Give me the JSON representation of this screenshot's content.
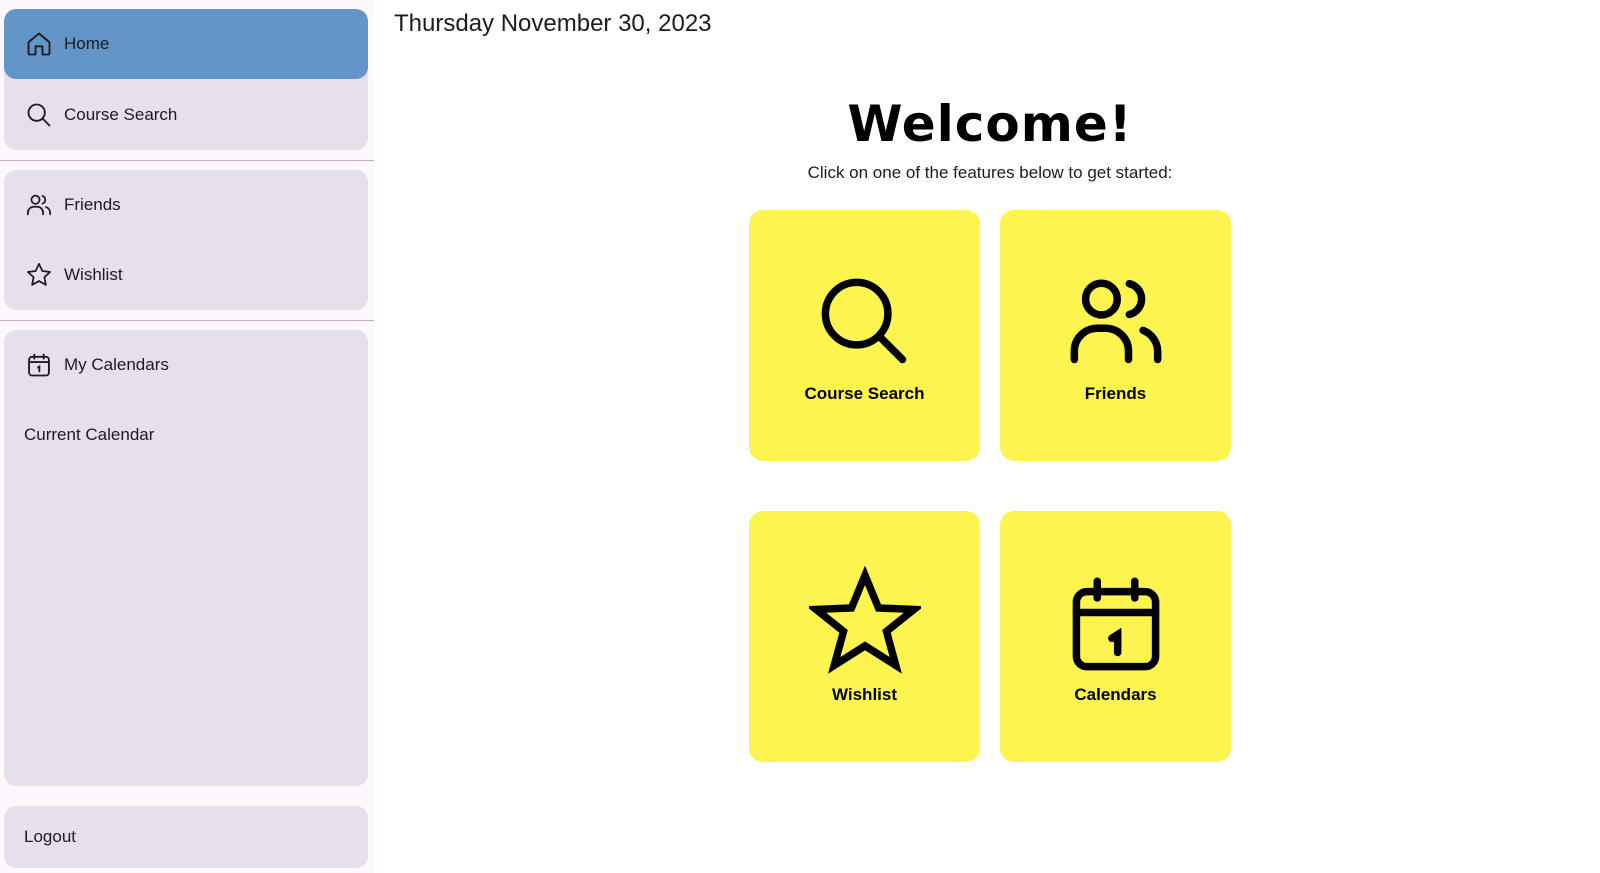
{
  "sidebar": {
    "primary": [
      {
        "label": "Home",
        "icon": "home-icon",
        "active": true
      },
      {
        "label": "Course Search",
        "icon": "search-icon",
        "active": false
      }
    ],
    "social": [
      {
        "label": "Friends",
        "icon": "friends-icon"
      },
      {
        "label": "Wishlist",
        "icon": "star-icon"
      }
    ],
    "calendars": {
      "my_calendars": {
        "label": "My Calendars",
        "icon": "calendar-icon"
      },
      "current_calendar": "Current Calendar"
    },
    "logout": "Logout"
  },
  "header": {
    "date": "Thursday November 30, 2023"
  },
  "main": {
    "title": "Welcome!",
    "subtitle": "Click on one of the features below to get started:",
    "tiles": [
      {
        "label": "Course Search",
        "icon": "search-icon"
      },
      {
        "label": "Friends",
        "icon": "friends-icon"
      },
      {
        "label": "Wishlist",
        "icon": "star-icon"
      },
      {
        "label": "Calendars",
        "icon": "calendar-icon"
      }
    ]
  },
  "colors": {
    "active_nav": "#6495c8",
    "nav_group_bg": "#e7e0ec",
    "tile_bg": "#fef44f",
    "divider": "#c9a9c6"
  }
}
